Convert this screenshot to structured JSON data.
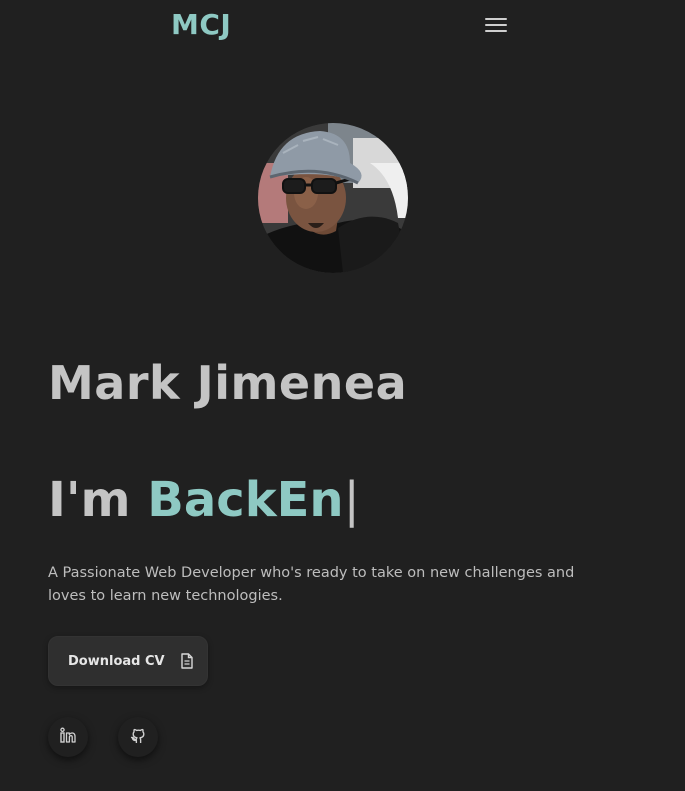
{
  "navbar": {
    "logo": "MCJ",
    "menu_icon": "hamburger-menu-icon"
  },
  "hero": {
    "avatar_alt": "Profile photo",
    "name": "Mark Jimenea",
    "role_prefix": "I'm ",
    "role_typed": "BackEn",
    "role_cursor": "|",
    "tagline": "A Passionate Web Developer who's ready to take on new challenges and loves to learn new technologies.",
    "download_button": "Download CV",
    "download_icon": "document-icon"
  },
  "social": [
    {
      "name": "linkedin",
      "icon": "linkedin-icon"
    },
    {
      "name": "github",
      "icon": "github-icon"
    }
  ],
  "colors": {
    "background": "#202020",
    "accent": "#8ec9c3",
    "text": "#c4c4c4",
    "button": "#2f2f2f"
  }
}
